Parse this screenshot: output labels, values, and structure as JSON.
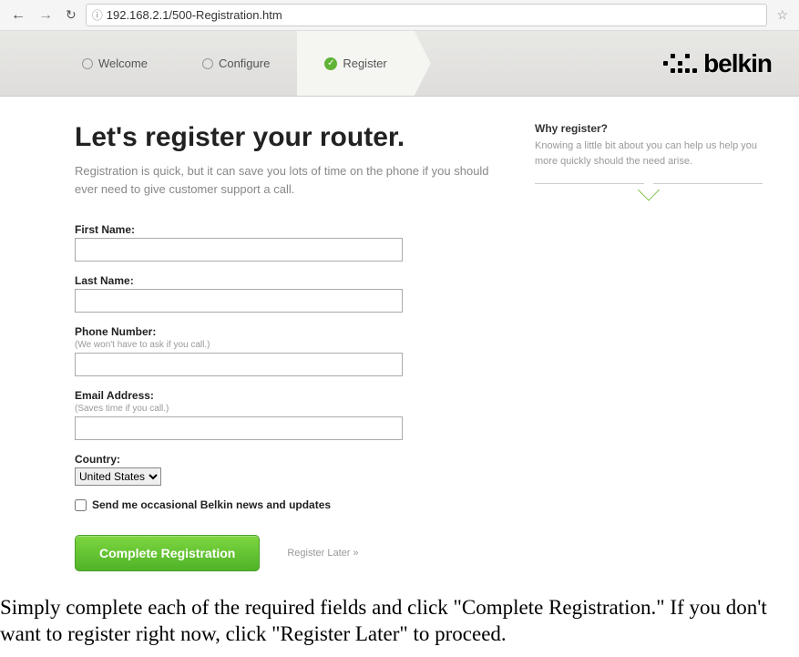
{
  "browser": {
    "url": "192.168.2.1/500-Registration.htm"
  },
  "steps": {
    "welcome": "Welcome",
    "configure": "Configure",
    "register": "Register"
  },
  "brand": {
    "name": "belkin"
  },
  "main": {
    "heading": "Let's register your router.",
    "intro": "Registration is quick, but it can save you lots of time on the phone if you should ever need to give customer support a call."
  },
  "form": {
    "first_name": {
      "label": "First Name:",
      "value": ""
    },
    "last_name": {
      "label": "Last Name:",
      "value": ""
    },
    "phone": {
      "label": "Phone Number:",
      "hint": "(We won't have to ask if you call.)",
      "value": ""
    },
    "email": {
      "label": "Email Address:",
      "hint": "(Saves time if you call.)",
      "value": ""
    },
    "country": {
      "label": "Country:",
      "selected": "United States"
    },
    "newsletter": {
      "label": "Send me occasional Belkin news and updates",
      "checked": false
    },
    "submit": "Complete Registration",
    "skip": "Register Later »"
  },
  "sidebar": {
    "title": "Why register?",
    "body": "Knowing a little bit about you can help us help you more quickly should the need arise."
  },
  "footer_instruction": "Simply complete each of the required fields and click \"Complete Registration.\" If you don't want to register right now, click \"Register Later\" to proceed."
}
